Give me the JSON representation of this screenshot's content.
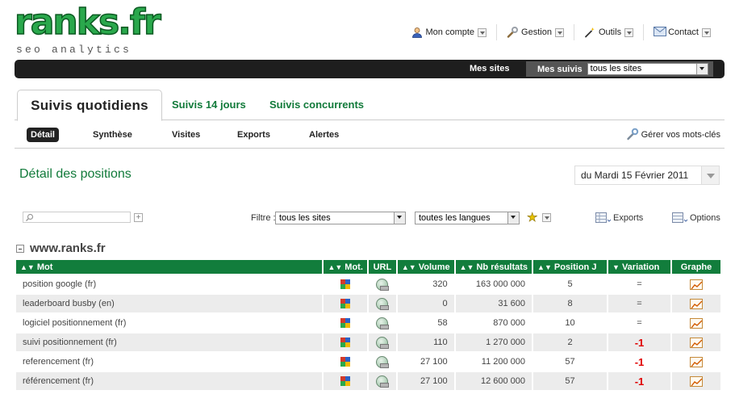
{
  "logo": {
    "main": "ranks.fr",
    "sub": "seo analytics"
  },
  "topnav": [
    {
      "label": "Mon compte",
      "icon": "user-icon"
    },
    {
      "label": "Gestion",
      "icon": "wrench-icon"
    },
    {
      "label": "Outils",
      "icon": "magic-wand-icon"
    },
    {
      "label": "Contact",
      "icon": "envelope-icon"
    }
  ],
  "blackbar": {
    "mes_sites": "Mes sites",
    "mes_suivis": "Mes suivis",
    "site_select": "tous les sites"
  },
  "tabs": [
    {
      "label": "Suivis quotidiens",
      "active": true
    },
    {
      "label": "Suivis 14 jours"
    },
    {
      "label": "Suivis concurrents"
    }
  ],
  "subnav": {
    "items": [
      "Détail",
      "Synthèse",
      "Visites",
      "Exports",
      "Alertes"
    ],
    "manage": "Gérer vos mots-clés"
  },
  "section_title": "Détail des positions",
  "date_select": "du Mardi 15 Février 2011",
  "filters": {
    "search_value": "",
    "filtre_label": "Filtre :",
    "site_filter": "tous les sites",
    "lang_filter": "toutes les langues",
    "exports": "Exports",
    "options": "Options"
  },
  "site_name": "www.ranks.fr",
  "table": {
    "headers": [
      "Mot",
      "Mot.",
      "URL",
      "Volume",
      "Nb résultats",
      "Position J",
      "Variation",
      "Graphe"
    ],
    "rows": [
      {
        "mot": "position google (fr)",
        "volume": "320",
        "nb": "163 000 000",
        "pos": "5",
        "var": "="
      },
      {
        "mot": "leaderboard busby (en)",
        "volume": "0",
        "nb": "31 600",
        "pos": "8",
        "var": "="
      },
      {
        "mot": "logiciel positionnement (fr)",
        "volume": "58",
        "nb": "870 000",
        "pos": "10",
        "var": "="
      },
      {
        "mot": "suivi positionnement (fr)",
        "volume": "110",
        "nb": "1 270 000",
        "pos": "2",
        "var": "-1"
      },
      {
        "mot": "referencement (fr)",
        "volume": "27 100",
        "nb": "11 200 000",
        "pos": "57",
        "var": "-1"
      },
      {
        "mot": "référencement (fr)",
        "volume": "27 100",
        "nb": "12 600 000",
        "pos": "57",
        "var": "-1"
      }
    ]
  },
  "colors": {
    "brand_green": "#127d3c",
    "negative": "#e00000",
    "dark_bar": "#1e1e1e"
  }
}
